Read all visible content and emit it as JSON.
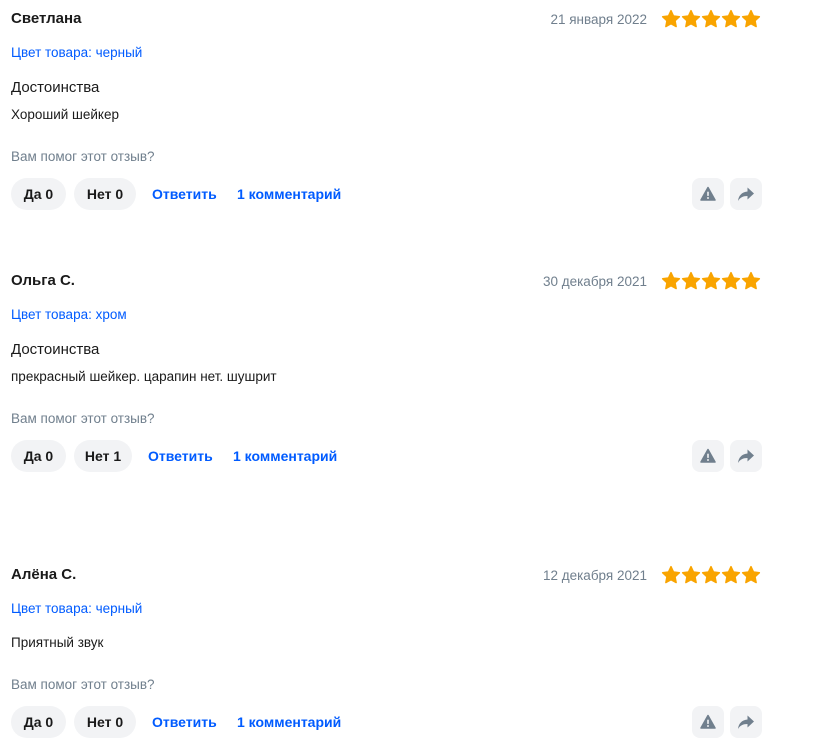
{
  "colors": {
    "accent": "#005bff",
    "star": "#f9a400",
    "muted": "#707f8d",
    "pill_bg": "#f2f3f5"
  },
  "helpful_prompt": "Вам помог этот отзыв?",
  "reviews": [
    {
      "author": "Светлана",
      "date": "21 января 2022",
      "rating": 5,
      "color_label": "Цвет товара: черный",
      "section_title": "Достоинства",
      "text": "Хороший шейкер",
      "yes_label": "Да 0",
      "no_label": "Нет 0",
      "reply_label": "Ответить",
      "comments_label": "1 комментарий"
    },
    {
      "author": "Ольга С.",
      "date": "30 декабря 2021",
      "rating": 5,
      "color_label": "Цвет товара: хром",
      "section_title": "Достоинства",
      "text": "прекрасный шейкер. царапин нет. шушрит",
      "yes_label": "Да 0",
      "no_label": "Нет 1",
      "reply_label": "Ответить",
      "comments_label": "1 комментарий"
    },
    {
      "author": "Алёна С.",
      "date": "12 декабря 2021",
      "rating": 5,
      "color_label": "Цвет товара: черный",
      "text": "Приятный звук",
      "yes_label": "Да 0",
      "no_label": "Нет 0",
      "reply_label": "Ответить",
      "comments_label": "1 комментарий"
    }
  ],
  "icons": {
    "report": "warning-icon",
    "share": "share-icon",
    "star": "star-icon"
  }
}
